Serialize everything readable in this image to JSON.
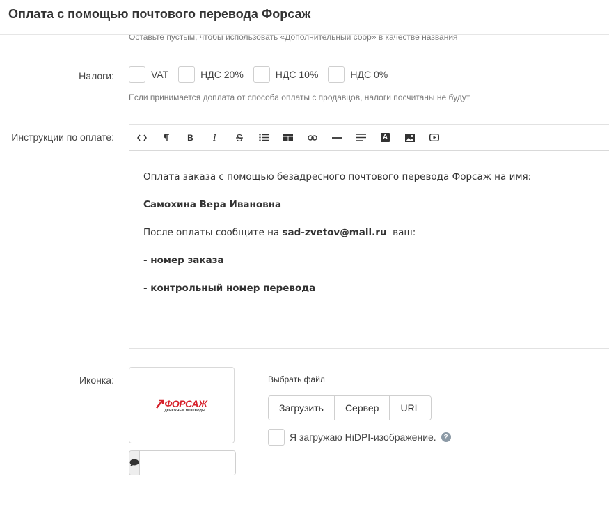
{
  "header": {
    "title": "Оплата с помощью почтового перевода Форсаж"
  },
  "name_hint": "Оставьте пустым, чтобы использовать «Дополнительный сбор» в качестве названия",
  "taxes": {
    "label": "Налоги:",
    "options": [
      "VAT",
      "НДС 20%",
      "НДС 10%",
      "НДС 0%"
    ],
    "hint": "Если принимается доплата от способа оплаты с продавцов, налоги посчитаны не будут"
  },
  "instructions": {
    "label": "Инструкции по оплате:",
    "toolbar_icons": [
      "code-view-icon",
      "paragraph-icon",
      "bold-icon",
      "italic-icon",
      "strikethrough-icon",
      "bullet-list-icon",
      "table-icon",
      "link-icon",
      "horizontal-rule-icon",
      "align-icon",
      "font-color-icon",
      "image-icon",
      "video-icon"
    ],
    "toolbar_labels": {
      "bold": "B",
      "italic": "I",
      "font_color": "A"
    },
    "content": {
      "line1": "Оплата заказа с помощью безадресного почтового перевода Форсаж на имя:",
      "name": "Самохина Вера Ивановна",
      "line3_prefix": "После оплаты сообщите на ",
      "email": "sad-zvetov@mail.ru",
      "line3_suffix": "  ваш:",
      "item1": "- номер заказа",
      "item2": "- контрольный номер перевода"
    }
  },
  "icon": {
    "label": "Иконка:",
    "logo_text": "ФОРСАЖ",
    "logo_subtext": "ДЕНЕЖНЫЕ ПЕРЕВОДЫ",
    "brand_color": "#d6202a",
    "choose_file": "Выбрать файл",
    "buttons": {
      "upload": "Загрузить",
      "server": "Сервер",
      "url": "URL"
    },
    "hidpi_label": "Я загружаю HiDPI-изображение.",
    "help": "?",
    "comment_value": ""
  }
}
